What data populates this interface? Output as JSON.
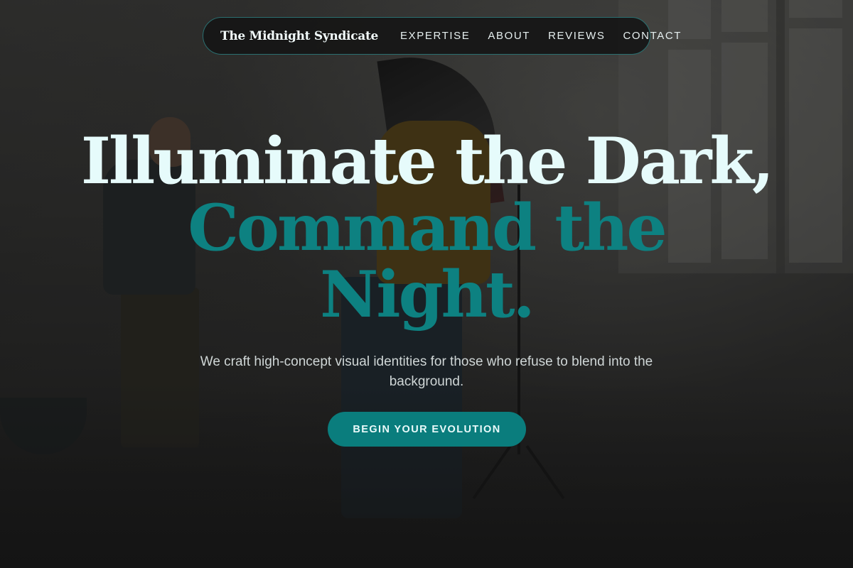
{
  "nav": {
    "brand": "The Midnight Syndicate",
    "links": [
      {
        "label": "EXPERTISE"
      },
      {
        "label": "ABOUT"
      },
      {
        "label": "REVIEWS"
      },
      {
        "label": "CONTACT"
      }
    ]
  },
  "hero": {
    "headline_line_1": "Illuminate the Dark,",
    "headline_line_2": "Command the",
    "headline_line_3": "Night.",
    "subtitle": "We craft high-concept visual identities for those who refuse to blend into the background.",
    "cta_label": "BEGIN YOUR EVOLUTION"
  },
  "colors": {
    "accent": "#0d8181",
    "headline_light": "#e6fbfb",
    "nav_border": "#2a6f70",
    "cta_background": "#0a7d7d"
  }
}
